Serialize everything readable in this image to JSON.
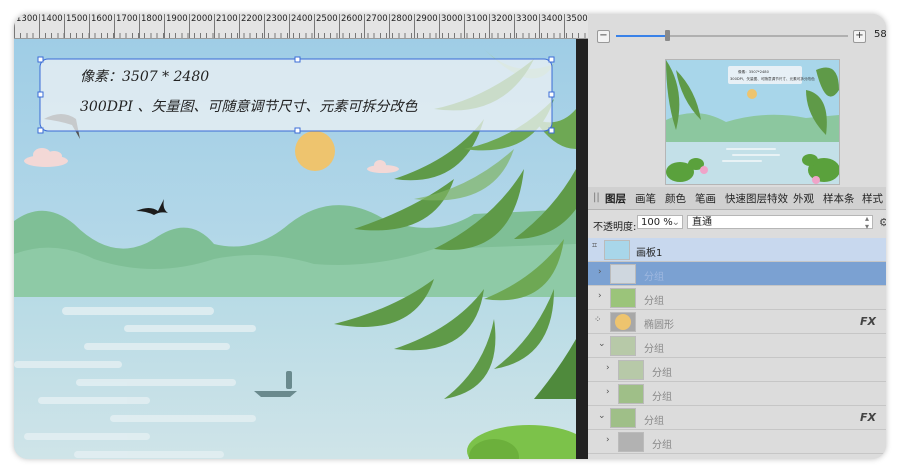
{
  "ruler": {
    "ticks": [
      "1300",
      "1400",
      "1500",
      "1600",
      "1700",
      "1800",
      "1900",
      "2000",
      "2100",
      "2200",
      "2300",
      "2400",
      "2500",
      "2600",
      "2700",
      "2800",
      "2900",
      "3000",
      "3100",
      "3200",
      "3300",
      "3400",
      "3500"
    ]
  },
  "artwork": {
    "line1": "像素：3507 * 2480",
    "line2": "300DPI 、矢量图、可随意调节尺寸、元素可拆分改色"
  },
  "zoom": {
    "minus": "−",
    "plus": "+",
    "value": "58",
    "level_fraction": 0.22
  },
  "navigator": {
    "line1": "像素：3507*2480",
    "line2": "300DPI、矢量图、可随意调节尺寸、元素可拆分改色"
  },
  "tabs": [
    "图层",
    "画笔",
    "颜色",
    "笔画",
    "快速图层特效",
    "外观",
    "样本条",
    "样式"
  ],
  "opacity": {
    "label": "不透明度:",
    "value": "100 %",
    "blend_mode": "直通"
  },
  "layers": [
    {
      "name": "画板1",
      "type": "board"
    },
    {
      "name": "分组",
      "type": "selected"
    },
    {
      "name": "分组",
      "type": "normal"
    },
    {
      "name": "椭圆形",
      "type": "normal",
      "fx": "FX"
    },
    {
      "name": "分组",
      "type": "normal"
    },
    {
      "name": "分组",
      "type": "normal"
    },
    {
      "name": "分组",
      "type": "normal"
    },
    {
      "name": "分组",
      "type": "normal",
      "fx": "FX"
    },
    {
      "name": "分组",
      "type": "normal"
    }
  ],
  "colors": {
    "accent": "#3a82e8",
    "selection": "#7ba1d2",
    "sky": "#a8d2e6",
    "sun": "#eec46e",
    "leaf": "#5f9a48"
  }
}
